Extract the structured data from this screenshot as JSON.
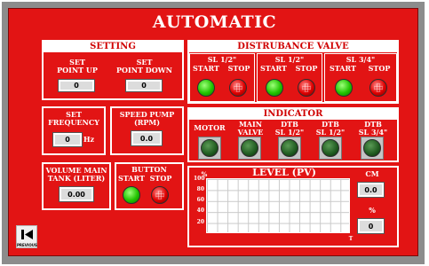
{
  "title": "AUTOMATIC",
  "setting": {
    "header": "SETTING",
    "point_up": {
      "label_line1": "SET",
      "label_line2": "POINT UP",
      "value": "0"
    },
    "point_down": {
      "label_line1": "SET",
      "label_line2": "POINT DOWN",
      "value": "0"
    }
  },
  "frequency": {
    "label_line1": "SET",
    "label_line2": "FREQUENCY",
    "value": "0",
    "unit": "Hz"
  },
  "speed_pump": {
    "label_line1": "SPEED PUMP",
    "label_line2": "(RPM)",
    "value": "0.0"
  },
  "volume": {
    "label_line1": "VOLUME MAIN",
    "label_line2": "TANK (LITER)",
    "value": "0.00"
  },
  "button": {
    "label": "BUTTON",
    "start": "START",
    "stop": "STOP"
  },
  "disturbance": {
    "header": "DISTRUBANCE VALVE",
    "valves": [
      {
        "name": "SL 1/2\"",
        "start": "START",
        "stop": "STOP"
      },
      {
        "name": "SL 1/2\"",
        "start": "START",
        "stop": "STOP"
      },
      {
        "name": "SL 3/4\"",
        "start": "START",
        "stop": "STOP"
      }
    ]
  },
  "indicator": {
    "header": "INDICATOR",
    "items": [
      {
        "line1": "MOTOR",
        "line2": ""
      },
      {
        "line1": "MAIN",
        "line2": "VALVE"
      },
      {
        "line1": "DTB",
        "line2": "SL 1/2\""
      },
      {
        "line1": "DTB",
        "line2": "SL 1/2\""
      },
      {
        "line1": "DTB",
        "line2": "SL 3/4\""
      }
    ]
  },
  "level": {
    "header": "LEVEL (PV)",
    "y_unit": "%",
    "x_unit": "T",
    "ticks": [
      "100",
      "80",
      "60",
      "40",
      "20"
    ],
    "cm_label": "CM",
    "cm_value": "0.0",
    "pct_label": "%",
    "pct_value": "0"
  },
  "previous_label": "PREVIOUS",
  "colors": {
    "panel": "#e21414",
    "frame": "#8c8c8c",
    "start_led": "#21c400",
    "stop_led": "#e00000"
  }
}
